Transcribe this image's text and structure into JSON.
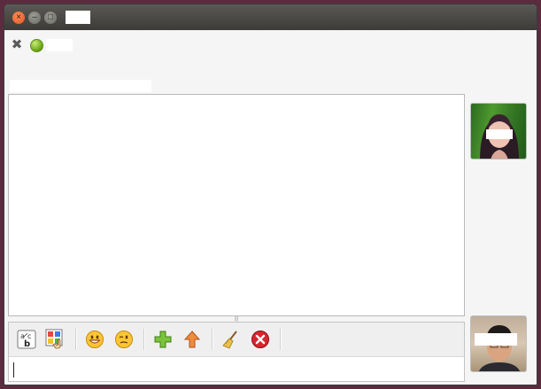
{
  "window": {
    "title": "",
    "buttons": {
      "close": "×",
      "minimize": "–",
      "maximize": "□"
    }
  },
  "contact": {
    "close_symbol": "✖",
    "status": "online",
    "status_color": "#73ad1c",
    "name": "",
    "status_message": "",
    "avatar_label": ""
  },
  "self": {
    "avatar_label": ""
  },
  "toolbar": {
    "items": [
      {
        "name": "spellcheck-icon"
      },
      {
        "name": "font-color-icon"
      },
      {
        "name": "smiley-icon"
      },
      {
        "name": "wink-smiley-icon"
      },
      {
        "name": "add-icon"
      },
      {
        "name": "upload-icon"
      },
      {
        "name": "broom-icon"
      },
      {
        "name": "stop-icon"
      }
    ]
  },
  "splitter": {
    "grip": "|||"
  },
  "input": {
    "value": ""
  }
}
